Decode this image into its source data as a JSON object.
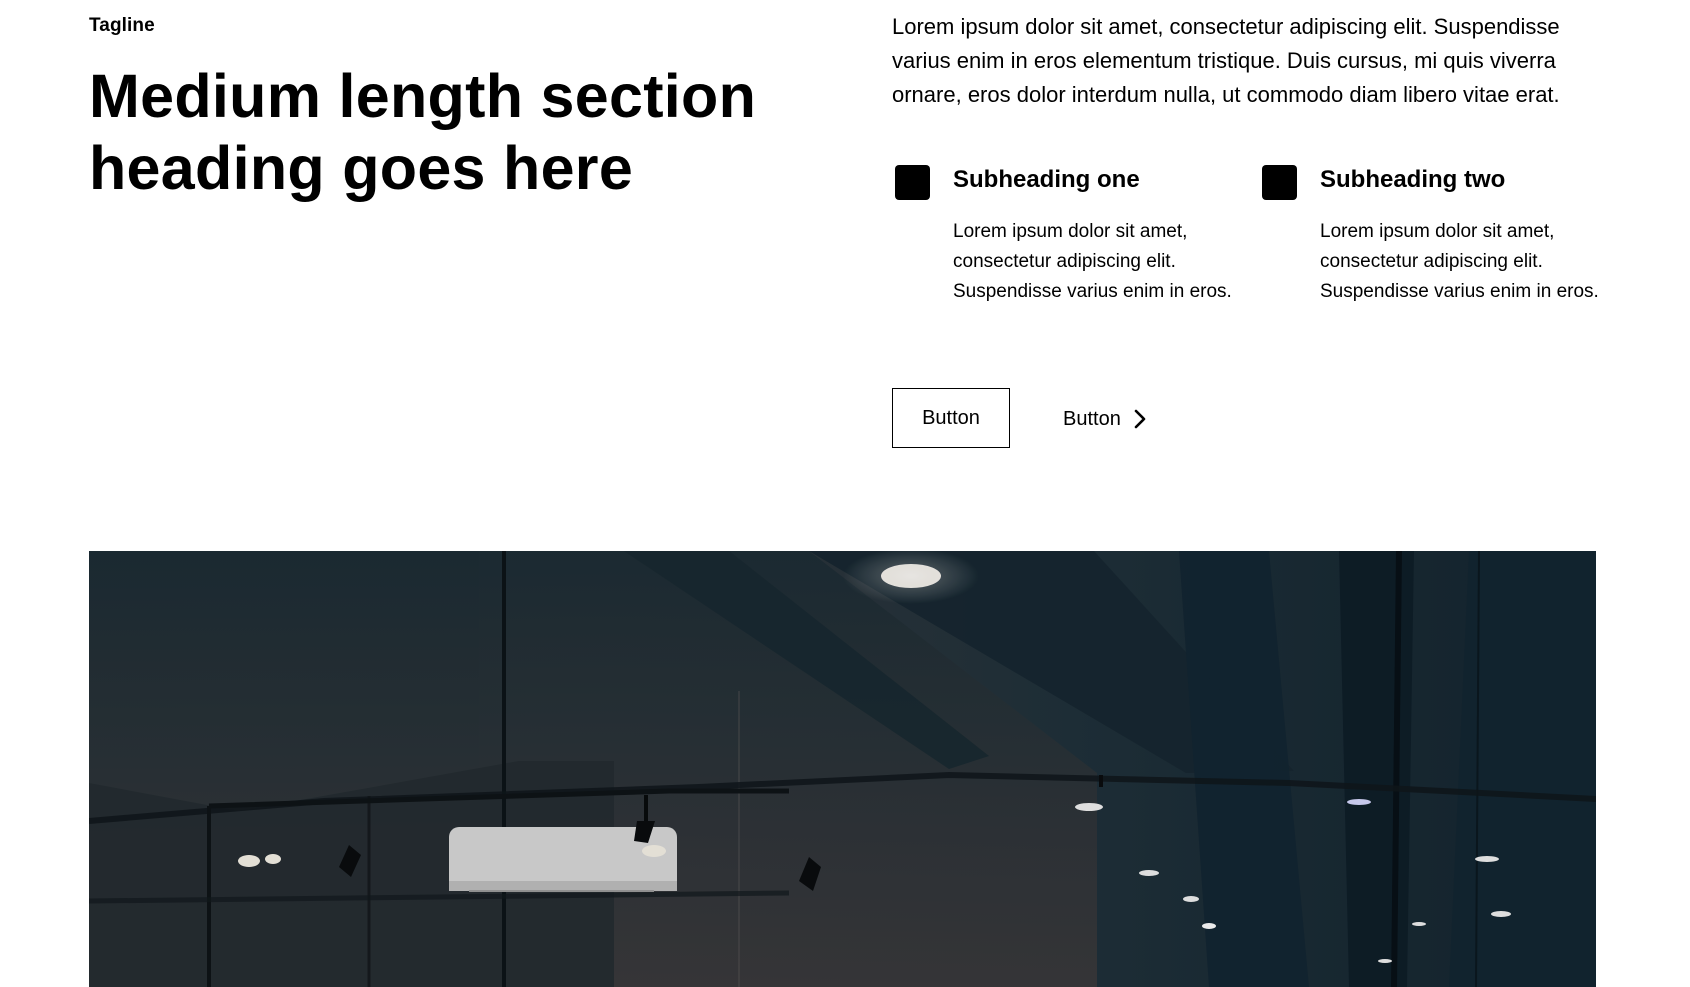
{
  "section": {
    "tagline": "Tagline",
    "heading": "Medium length section heading goes here",
    "intro": "Lorem ipsum dolor sit amet, consectetur adipiscing elit. Suspendisse varius enim in eros elementum tristique. Duis cursus, mi quis viverra ornare, eros dolor interdum nulla, ut commodo diam libero vitae erat."
  },
  "features": [
    {
      "icon": "square-icon",
      "title": "Subheading one",
      "body": "Lorem ipsum dolor sit amet, consectetur adipiscing elit. Suspendisse varius enim in eros."
    },
    {
      "icon": "square-icon",
      "title": "Subheading two",
      "body": "Lorem ipsum dolor sit amet, consectetur adipiscing elit. Suspendisse varius enim in eros."
    }
  ],
  "actions": {
    "primary_label": "Button",
    "link_label": "Button",
    "link_icon": "chevron-right-icon"
  },
  "colors": {
    "text": "#000000",
    "background": "#ffffff",
    "image_tone": "#1b2a33"
  }
}
